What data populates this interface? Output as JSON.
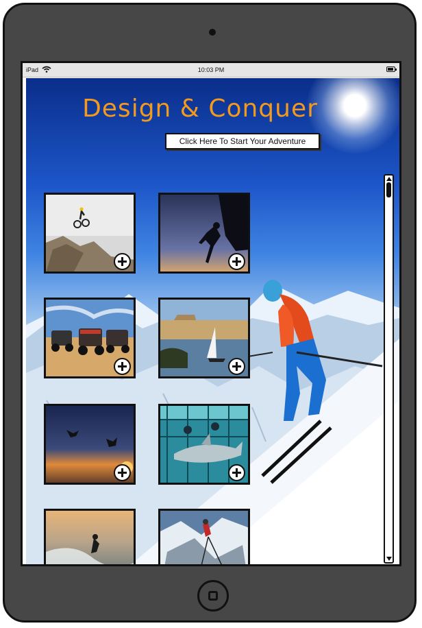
{
  "device": {
    "type": "iPad"
  },
  "statusbar": {
    "carrier": "iPad",
    "time": "10:03 PM"
  },
  "hero": {
    "title": "Design & Conquer",
    "start_button": "Click Here To Start Your Adventure"
  },
  "tiles": [
    {
      "name": "bmx-jump-tile"
    },
    {
      "name": "rock-climbing-tile"
    },
    {
      "name": "dune-buggies-tile"
    },
    {
      "name": "sailing-nile-tile"
    },
    {
      "name": "skydiving-tile"
    },
    {
      "name": "shark-cage-tile"
    },
    {
      "name": "surfing-tile"
    },
    {
      "name": "ice-climbing-tile"
    }
  ],
  "colors": {
    "title": "#f39a1e",
    "frame": "#474747"
  }
}
